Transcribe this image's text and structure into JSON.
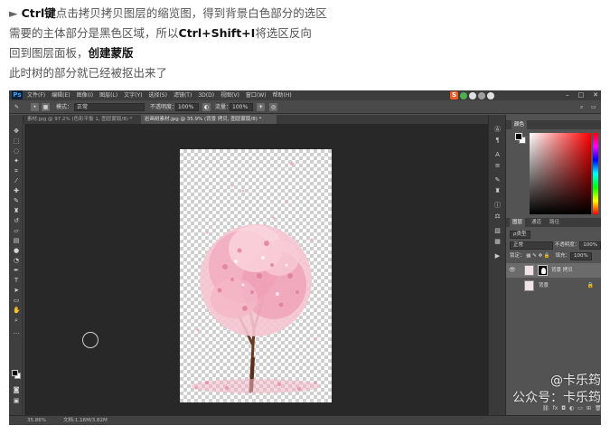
{
  "instructions": {
    "line1_arrow": "►",
    "line1_key": "Ctrl键",
    "line1_rest": "点击拷贝拷贝图层的缩览图，得到背景白色部分的选区",
    "line2_a": "需要的主体部分是黑色区域，所以",
    "line2_key": "Ctrl+Shift+I",
    "line2_b": "将选区反向",
    "line3_a": "回到图层面板，",
    "line3_em": "创建蒙版",
    "line4": "此时树的部分就已经被抠出来了"
  },
  "app": {
    "logo": "Ps",
    "menu": [
      "文件(F)",
      "编辑(E)",
      "图像(I)",
      "图层(L)",
      "文字(Y)",
      "选择(S)",
      "滤镜(T)",
      "3D(D)",
      "视图(V)",
      "窗口(W)",
      "帮助(H)"
    ],
    "ime_label": "S",
    "window_buttons": [
      "–",
      "□",
      "✕"
    ]
  },
  "options": {
    "mode_label": "模式：",
    "mode_value": "正常",
    "opacity_label": "不透明度：",
    "opacity_value": "100%",
    "flow_label": "流量：",
    "flow_value": "100%"
  },
  "tabs": [
    {
      "label": "素材.jpg @ 97.2% (色彩平衡 1, 图层蒙版/8) *"
    },
    {
      "label": "岩画树素材.jpg @ 35.9% (背景 拷贝, 图层蒙版/8) *"
    }
  ],
  "panels": {
    "color_tabs": [
      "颜色"
    ],
    "layers_tabs": [
      "图层",
      "通道",
      "路径"
    ],
    "kind_label": "ρ类型",
    "blend_mode": "正常",
    "opacity_label": "不透明度：",
    "opacity_value": "100%",
    "lock_label": "锁定：",
    "fill_label": "填充：",
    "fill_value": "100%",
    "layers": [
      {
        "name": "背景 拷贝",
        "selected": true
      },
      {
        "name": "背景",
        "selected": false
      }
    ]
  },
  "status": {
    "zoom": "35.86%",
    "doc": "文档:1.16M/3.82M"
  },
  "watermark": {
    "line1": "@卡乐筠",
    "line2": "公众号：卡乐筠"
  },
  "colors": {
    "accent_blue": "#31a8ff",
    "ime_orange": "#f15a24",
    "blossom": "#f29db4"
  }
}
